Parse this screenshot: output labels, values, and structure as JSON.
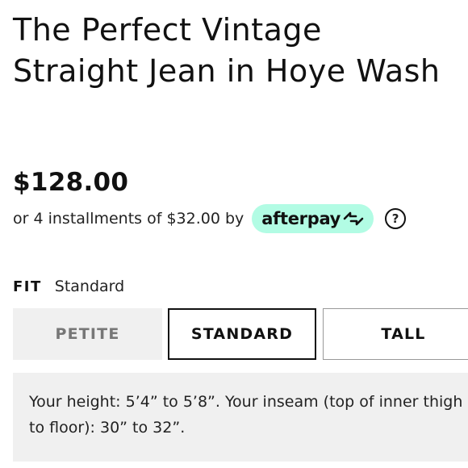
{
  "product": {
    "title": "The Perfect Vintage Straight Jean in Hoye Wash",
    "price": "$128.00"
  },
  "afterpay": {
    "installments_text": "or 4 installments of $32.00 by",
    "brand": "afterpay",
    "help_symbol": "?",
    "badge_color": "#b2fce4"
  },
  "fit": {
    "label": "FIT",
    "selected": "Standard",
    "options": [
      {
        "label": "PETITE",
        "state": "unavailable"
      },
      {
        "label": "STANDARD",
        "state": "selected"
      },
      {
        "label": "TALL",
        "state": "available"
      }
    ],
    "description": "Your height: 5’4” to 5’8”. Your inseam (top of inner thigh to floor): 30” to 32”."
  }
}
